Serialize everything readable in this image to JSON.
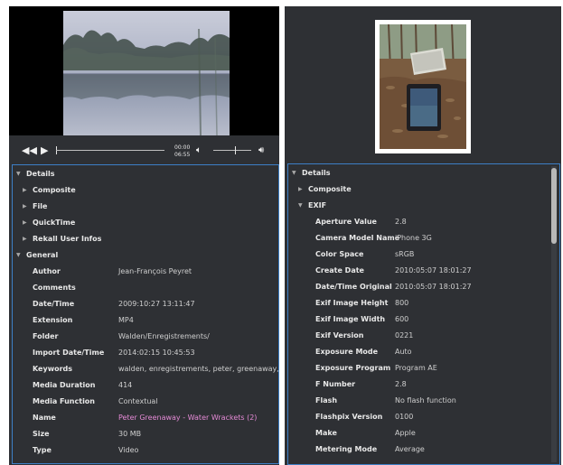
{
  "left": {
    "player": {
      "time_current": "00:00",
      "time_total": "06:55"
    },
    "tree": {
      "root": "Details",
      "groups": [
        "Composite",
        "File",
        "QuickTime",
        "Rekall User Infos"
      ],
      "open_group": "General",
      "rows": [
        {
          "key": "Author",
          "value": "Jean-François Peyret"
        },
        {
          "key": "Comments",
          "value": ""
        },
        {
          "key": "Date/Time",
          "value": "2009:10:27 13:11:47"
        },
        {
          "key": "Extension",
          "value": "MP4"
        },
        {
          "key": "Folder",
          "value": "Walden/Enregistrements/"
        },
        {
          "key": "Import Date/Time",
          "value": "2014:02:15 10:45:53"
        },
        {
          "key": "Keywords",
          "value": "walden, enregistrements, peter, greenaway, wate"
        },
        {
          "key": "Media Duration",
          "value": "414"
        },
        {
          "key": "Media Function",
          "value": "Contextual"
        },
        {
          "key": "Name",
          "value": "Peter Greenaway - Water Wrackets (2)"
        },
        {
          "key": "Size",
          "value": "30 MB"
        },
        {
          "key": "Type",
          "value": "Video"
        }
      ]
    }
  },
  "right": {
    "tree": {
      "root": "Details",
      "groups": [
        "Composite"
      ],
      "open_group": "EXIF",
      "rows": [
        {
          "key": "Aperture Value",
          "value": "2.8"
        },
        {
          "key": "Camera Model Name",
          "value": "iPhone 3G"
        },
        {
          "key": "Color Space",
          "value": "sRGB"
        },
        {
          "key": "Create Date",
          "value": "2010:05:07 18:01:27"
        },
        {
          "key": "Date/Time Original",
          "value": "2010:05:07 18:01:27"
        },
        {
          "key": "Exif Image Height",
          "value": "800"
        },
        {
          "key": "Exif Image Width",
          "value": "600"
        },
        {
          "key": "Exif Version",
          "value": "0221"
        },
        {
          "key": "Exposure Mode",
          "value": "Auto"
        },
        {
          "key": "Exposure Program",
          "value": "Program AE"
        },
        {
          "key": "F Number",
          "value": "2.8"
        },
        {
          "key": "Flash",
          "value": "No flash function"
        },
        {
          "key": "Flashpix Version",
          "value": "0100"
        },
        {
          "key": "Make",
          "value": "Apple"
        },
        {
          "key": "Metering Mode",
          "value": "Average"
        }
      ]
    }
  },
  "colors": {
    "panel_bg": "#2e3034",
    "frame_border": "#3d7fc6",
    "link": "#e58ad6"
  },
  "icons": {
    "rewind": "rewind-icon",
    "play": "play-icon",
    "volume_low": "volume-low-icon",
    "volume_high": "volume-high-icon",
    "expand": "triangle-right-icon",
    "collapse": "triangle-down-icon"
  }
}
